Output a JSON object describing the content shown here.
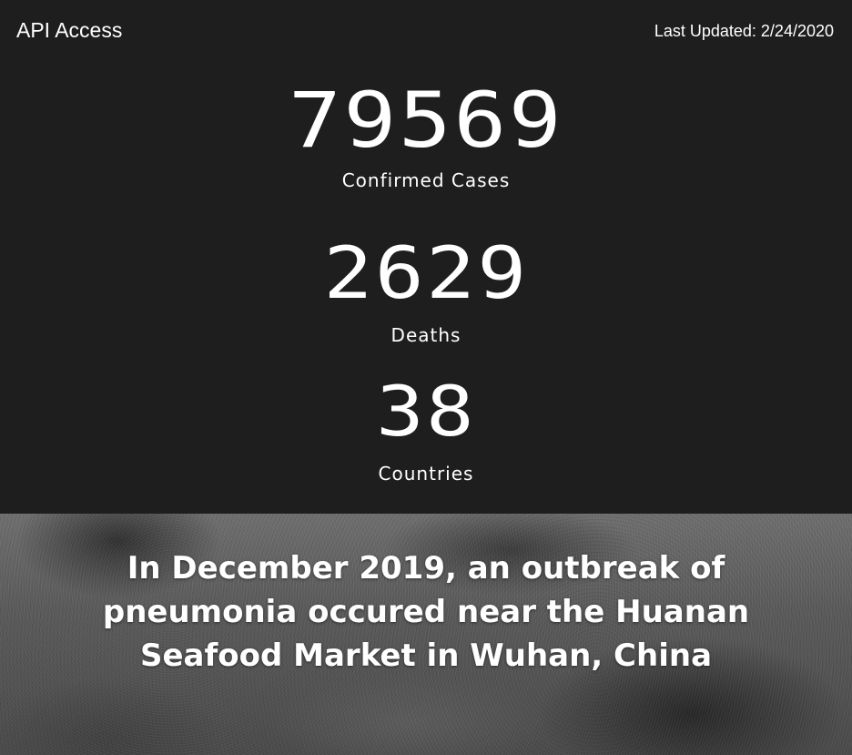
{
  "header": {
    "api_link_label": "API Access",
    "last_updated": "Last Updated: 2/24/2020"
  },
  "stats": {
    "confirmed": {
      "value": "79569",
      "label": "Confirmed Cases"
    },
    "deaths": {
      "value": "2629",
      "label": "Deaths"
    },
    "countries": {
      "value": "38",
      "label": "Countries"
    }
  },
  "hero": {
    "text": "In December 2019, an outbreak of pneumonia occured near the Huanan Seafood Market in Wuhan, China"
  },
  "colors": {
    "background": "#1e1e1e",
    "text": "#ffffff"
  }
}
